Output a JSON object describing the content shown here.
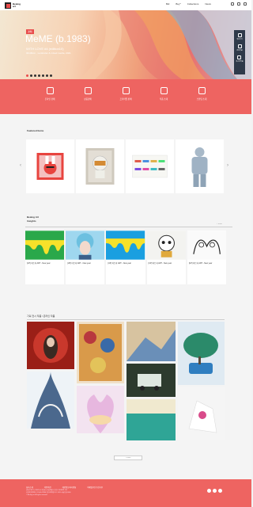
{
  "header": {
    "logo_line1": "Bealog",
    "logo_line2": "art",
    "nav": [
      "Bid",
      "Buy*",
      "Collections",
      "News"
    ]
  },
  "hero": {
    "category": "경매",
    "title": "MeME (b.1983)",
    "subtitle": "WITH LOVE #4 (edition10)",
    "desc": "30x30cm , Lenticular & mixed media, 2021",
    "side": [
      "위로가기",
      "관심작품",
      "최근본작품"
    ]
  },
  "services": [
    "온라인 경매",
    "상품경매",
    "프리미엄 판매",
    "작품 소개",
    "브랜딩 소개"
  ],
  "sections": {
    "featured": "Featured Items",
    "insights_line1": "Bealog Art",
    "insights_line2": "Insights",
    "insights_more": "+ more",
    "gallery": "기획 전시 작품 / 온라인 작품",
    "more": "+ more"
  },
  "insights": [
    {
      "title": "[UP] 아트웍 ART - New year"
    },
    {
      "title": "[UP] 아트웍 ART - New year"
    },
    {
      "title": "[UP] 아트웍 ART - New year"
    },
    {
      "title": "[UP] 아트웍 ART - New year"
    },
    {
      "title": "[UP] 아트웍 ART - New year"
    }
  ],
  "footer": {
    "links": [
      "회사소개",
      "이용약관",
      "개인정보처리방침",
      "이메일무단수집거부"
    ],
    "info": [
      "(주)비아로그 | 대표이사: 홍길동 | 서울특별시 강남구 테헤란로 123",
      "사업자등록번호: 123-45-67890 | 통신판매업신고: 2021-서울강남-0000",
      "© Bealog art. All rights reserved."
    ]
  },
  "colors": {
    "accent": "#ee6461",
    "dark": "#2f3a4a"
  }
}
